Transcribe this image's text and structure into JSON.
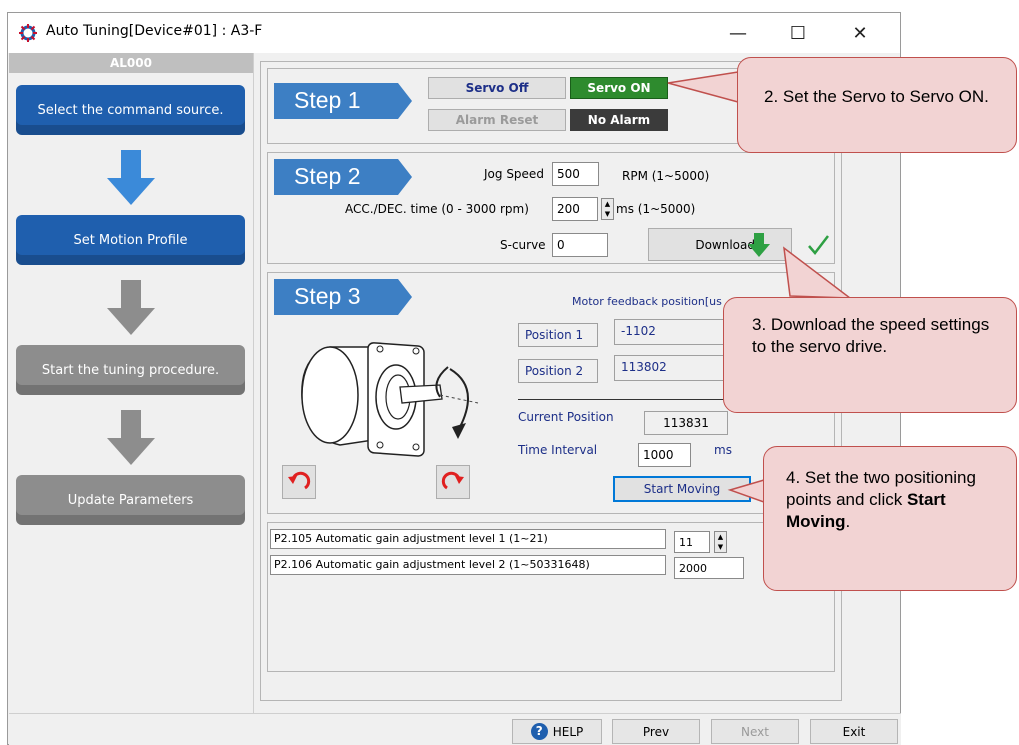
{
  "window": {
    "title": "Auto Tuning[Device#01] : A3-F",
    "minimize": "—",
    "maximize": "☐",
    "close": "✕"
  },
  "sidebar": {
    "alarm": "AL000",
    "items": [
      {
        "label": "Select the command source.",
        "state": "active"
      },
      {
        "label": "Set Motion Profile",
        "state": "active"
      },
      {
        "label": "Start the tuning procedure.",
        "state": "inactive"
      },
      {
        "label": "Update Parameters",
        "state": "inactive"
      }
    ]
  },
  "step1": {
    "title": "Step 1",
    "servo_off": "Servo Off",
    "servo_on": "Servo ON",
    "alarm_reset": "Alarm Reset",
    "no_alarm": "No Alarm"
  },
  "step2": {
    "title": "Step 2",
    "jog_speed_label": "Jog Speed",
    "jog_speed_value": "500",
    "jog_speed_range": "RPM (1~5000)",
    "acc_label": "ACC./DEC. time (0 - 3000 rpm)",
    "acc_value": "200",
    "acc_range": "ms (1~5000)",
    "scurve_label": "S-curve",
    "scurve_value": "0",
    "download": "Download"
  },
  "step3": {
    "title": "Step 3",
    "feedback_label": "Motor feedback position[us",
    "pos1_label": "Position 1",
    "pos1_value": "-1102",
    "pos2_label": "Position 2",
    "pos2_value": "113802",
    "current_label": "Current Position",
    "current_value": "113831",
    "interval_label": "Time Interval",
    "interval_value": "1000",
    "interval_unit": "ms",
    "start_moving": "Start Moving"
  },
  "params": [
    {
      "label": "P2.105 Automatic gain adjustment level 1 (1~21)",
      "value": "11"
    },
    {
      "label": "P2.106 Automatic gain adjustment level 2 (1~50331648)",
      "value": "2000"
    }
  ],
  "footer": {
    "help": "HELP",
    "prev": "Prev",
    "next": "Next",
    "exit": "Exit"
  },
  "callouts": {
    "c2": "2.  Set the Servo to Servo ON.",
    "c3": "3.  Download the speed settings to the servo drive.",
    "c4_pre": "4.  Set the two positioning points and click ",
    "c4_bold": "Start Moving",
    "c4_post": "."
  },
  "colors": {
    "accent_blue": "#1f5fae",
    "servo_on_green": "#2e8b2e",
    "no_alarm_dark": "#3b3b3b",
    "callout_fill": "#f2d3d3",
    "callout_border": "#c0504d"
  }
}
